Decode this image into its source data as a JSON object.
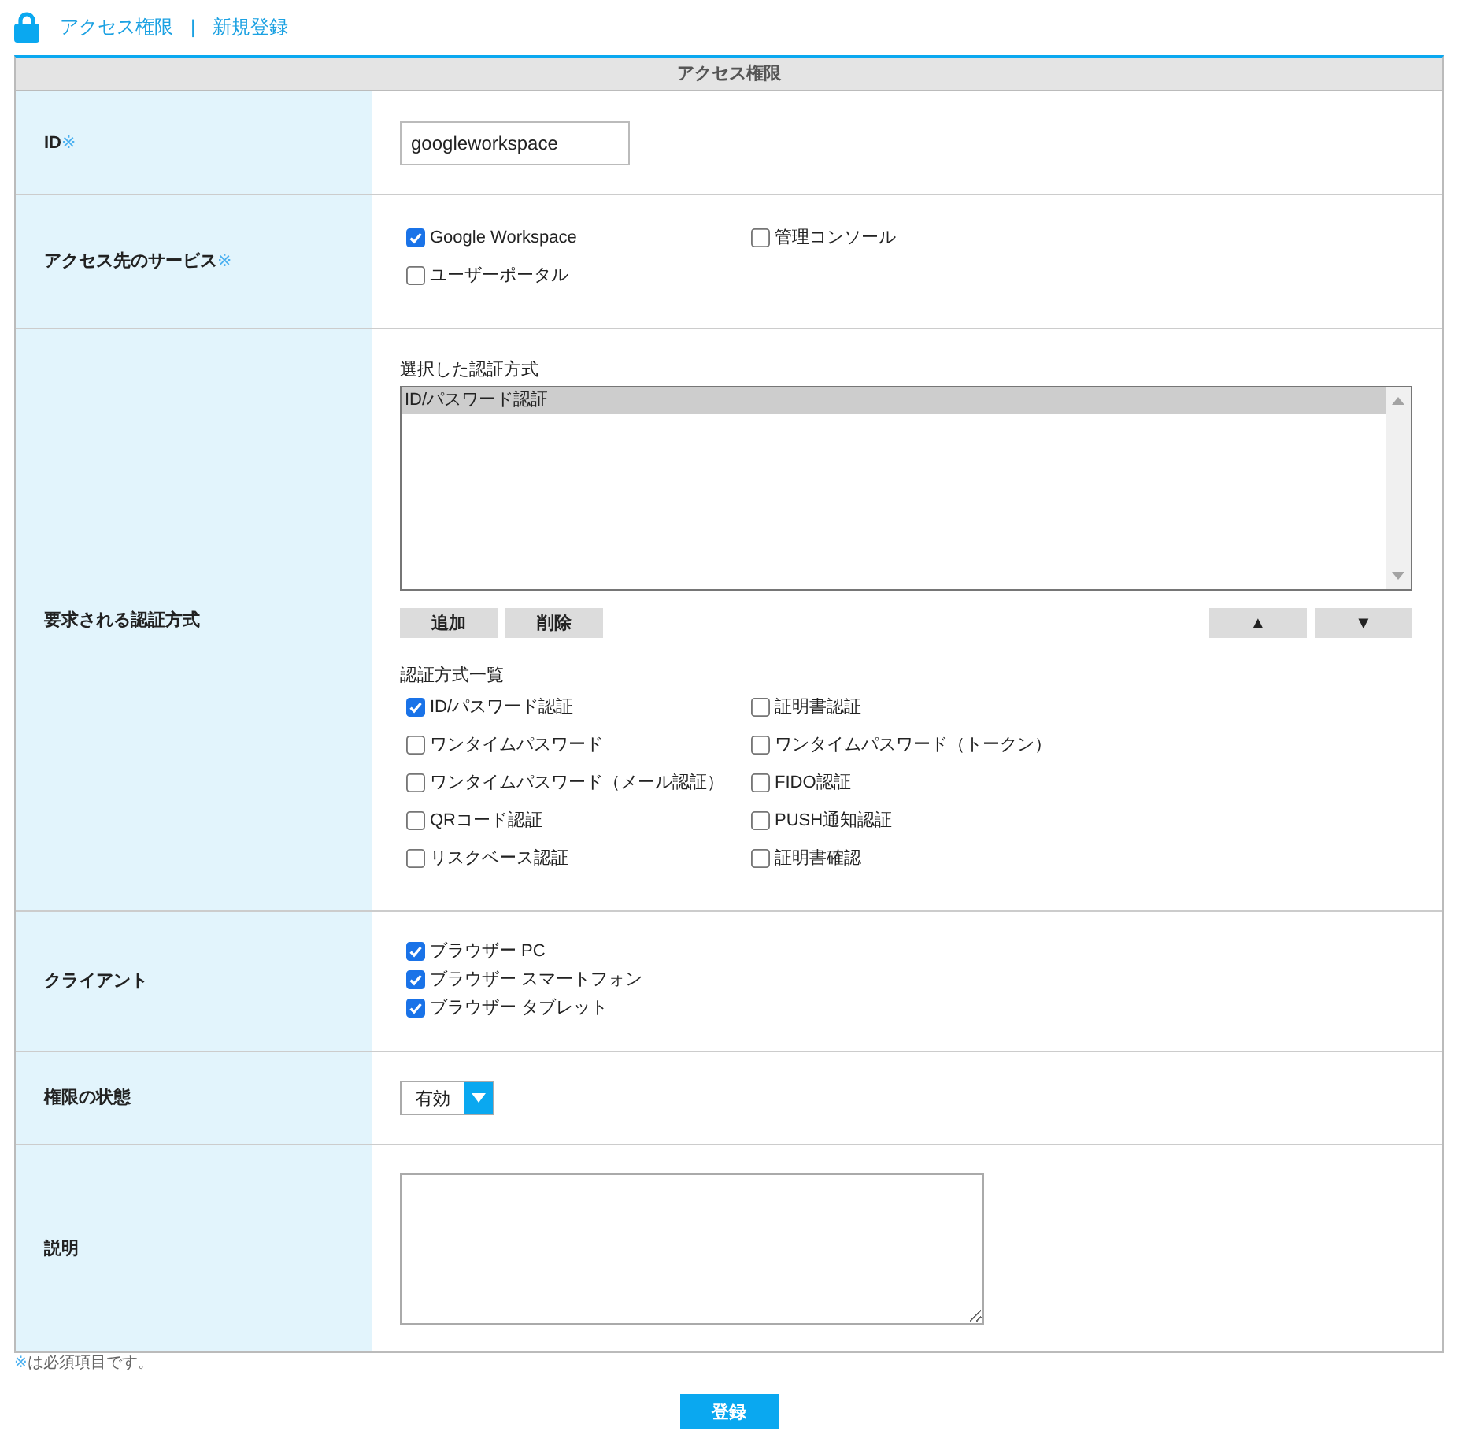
{
  "breadcrumb": {
    "items": [
      "アクセス権限",
      "新規登録"
    ],
    "separator": "|"
  },
  "panel": {
    "title": "アクセス権限"
  },
  "rows": [
    {
      "kind": "input",
      "label": "ID",
      "mark": "※",
      "value": "googleworkspace"
    },
    {
      "kind": "options",
      "label": "アクセス先のサービス",
      "mark": "※",
      "options": [
        {
          "label": "Google Workspace",
          "checked": true
        },
        {
          "label": "管理コンソール",
          "checked": false
        },
        {
          "label": "ユーザーポータル",
          "checked": false
        }
      ]
    },
    {
      "kind": "auth",
      "label": "要求される認証方式",
      "selected_caption": "選択した認証方式",
      "selected_list": [
        {
          "label": "ID/パスワード認証",
          "selected": true
        }
      ],
      "buttons": [
        "追加",
        "削除"
      ],
      "order_buttons": [
        "▲",
        "▼"
      ],
      "list_caption": "認証方式一覧",
      "options": [
        {
          "label": "ID/パスワード認証",
          "checked": true
        },
        {
          "label": "証明書認証",
          "checked": false
        },
        {
          "label": "ワンタイムパスワード",
          "checked": false
        },
        {
          "label": "ワンタイムパスワード（トークン）",
          "checked": false
        },
        {
          "label": "ワンタイムパスワード（メール認証）",
          "checked": false
        },
        {
          "label": "FIDO認証",
          "checked": false
        },
        {
          "label": "QRコード認証",
          "checked": false
        },
        {
          "label": "PUSH通知認証",
          "checked": false
        },
        {
          "label": "リスクベース認証",
          "checked": false
        },
        {
          "label": "証明書確認",
          "checked": false
        }
      ]
    },
    {
      "kind": "stack",
      "label": "クライアント",
      "options": [
        {
          "label": "ブラウザー PC",
          "checked": true
        },
        {
          "label": "ブラウザー スマートフォン",
          "checked": true
        },
        {
          "label": "ブラウザー タブレット",
          "checked": true
        }
      ]
    },
    {
      "kind": "select",
      "label": "権限の状態",
      "value": "有効"
    },
    {
      "kind": "textarea",
      "label": "説明"
    }
  ],
  "note": {
    "mark": "※",
    "text": "は必須項目です。"
  },
  "submit": {
    "label": "登録"
  }
}
